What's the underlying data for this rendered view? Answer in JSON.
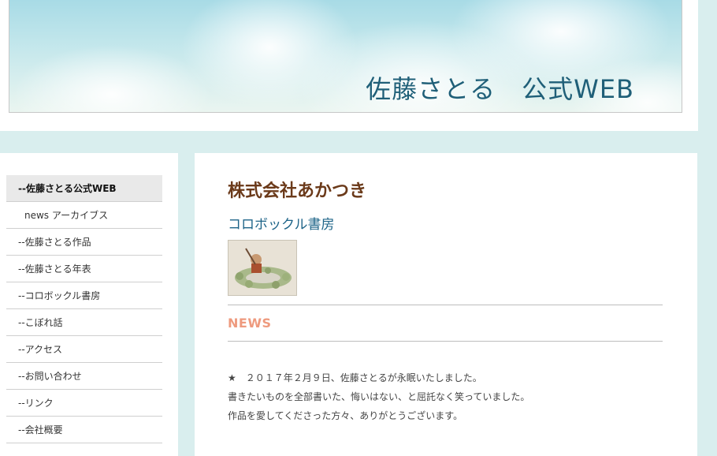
{
  "header": {
    "title": "佐藤さとる　公式WEB"
  },
  "sidebar": {
    "items": [
      {
        "label": "--佐藤さとる公式WEB"
      },
      {
        "label": "news アーカイブス"
      },
      {
        "label": "--佐藤さとる作品"
      },
      {
        "label": "--佐藤さとる年表"
      },
      {
        "label": "--コロボックル書房"
      },
      {
        "label": "--こぼれ話"
      },
      {
        "label": "--アクセス"
      },
      {
        "label": "--お問い合わせ"
      },
      {
        "label": "--リンク"
      },
      {
        "label": "--会社概要"
      }
    ]
  },
  "main": {
    "company_name": "株式会社あかつき",
    "subtitle": "コロボックル書房",
    "news_heading": "NEWS",
    "news_lines": [
      "★　２０１７年２月９日、佐藤さとるが永眠いたしました。",
      "書きたいものを全部書いた、悔いはない、と屈託なく笑っていました。",
      "作品を愛してくださった方々、ありがとうございます。"
    ]
  }
}
